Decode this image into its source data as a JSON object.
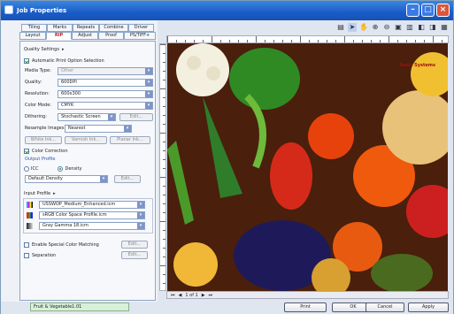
{
  "window": {
    "title": "Job Properties"
  },
  "tabs_row1": [
    "Tiling",
    "Marks",
    "Repeats",
    "Combine",
    "Driver"
  ],
  "tabs_row2": [
    "Layout",
    "RIP",
    "Adjust",
    "Proof",
    "PS/TIFF+"
  ],
  "quality_settings": {
    "label": "Quality Settings"
  },
  "auto_print": {
    "label": "Automatic Print Option Selection"
  },
  "media_type": {
    "label": "Media Type:",
    "value": "Other"
  },
  "quality": {
    "label": "Quality:",
    "value": "600DPI"
  },
  "resolution": {
    "label": "Resolution:",
    "value": "600x300"
  },
  "color_mode": {
    "label": "Color Mode:",
    "value": "CMYK"
  },
  "dithering": {
    "label": "Dithering:",
    "value": "Stochastic Screen",
    "edit": "Edit..."
  },
  "resample": {
    "label": "Resample Images:",
    "value": "Nearest"
  },
  "small_btns": [
    "White Ink...",
    "Varnish Ink...",
    "Planar Ink..."
  ],
  "color_correction": {
    "label": "Color Correction"
  },
  "output_profile": {
    "label": "Output Profile",
    "icc": "ICC",
    "density": "Density",
    "value": "Default Density",
    "edit": "Edit..."
  },
  "input_profile": {
    "label": "Input Profile",
    "profiles": [
      "USSWOP_Medium_Enhanced.icm",
      "sRGB Color Space Profile.icm",
      "Gray Gamma 18.icm"
    ]
  },
  "special_color": {
    "label": "Enable Special Color Matching",
    "edit": "Edit..."
  },
  "separation": {
    "label": "Separation",
    "edit": "Edit..."
  },
  "nav": {
    "page": "1 of 1"
  },
  "status": {
    "text": "Fruit & Vegetable1.01"
  },
  "buttons": {
    "print": "Print",
    "ok": "OK",
    "cancel": "Cancel",
    "apply": "Apply"
  },
  "watermark": {
    "text": "Sonic Systems"
  }
}
